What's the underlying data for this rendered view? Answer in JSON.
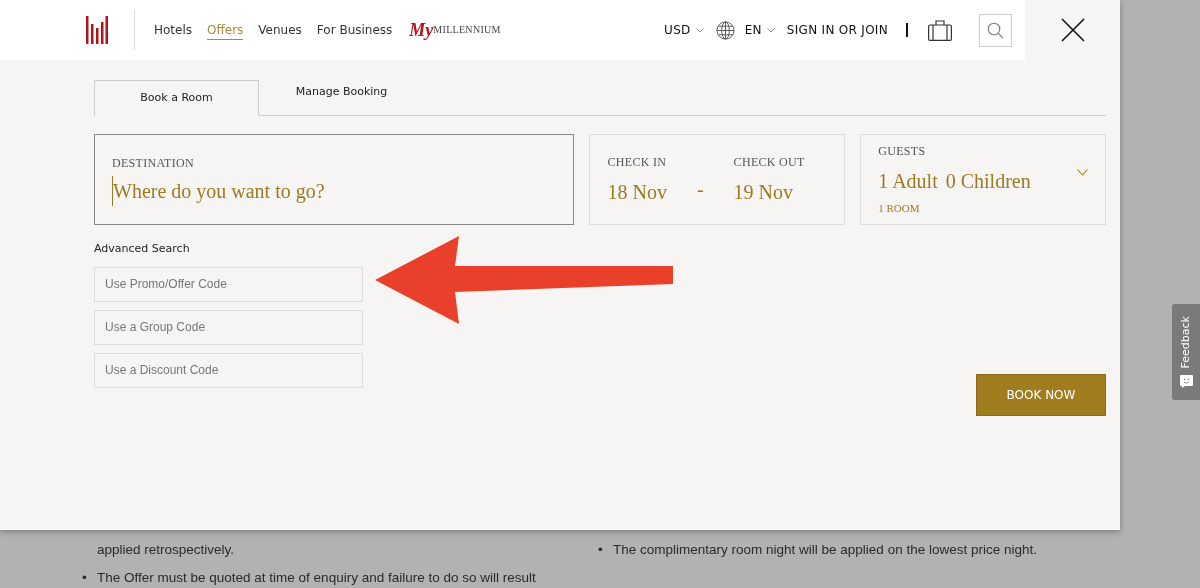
{
  "header": {
    "nav": [
      {
        "label": "Hotels",
        "selected": false
      },
      {
        "label": "Offers",
        "selected": true
      },
      {
        "label": "Venues",
        "selected": false
      },
      {
        "label": "For Business",
        "selected": false
      }
    ],
    "brand": {
      "script": "My",
      "name": "MILLENNIUM"
    },
    "currency": "USD",
    "language": "EN",
    "sign_in": "SIGN IN OR JOIN"
  },
  "tabs": [
    {
      "label": "Book a Room",
      "selected": true
    },
    {
      "label": "Manage Booking",
      "selected": false
    }
  ],
  "destination": {
    "label": "DESTINATION",
    "placeholder": "Where do you want to go?"
  },
  "dates": {
    "check_in": {
      "label": "CHECK IN",
      "value": "18 Nov"
    },
    "separator": "-",
    "check_out": {
      "label": "CHECK OUT",
      "value": "19 Nov"
    }
  },
  "guests": {
    "label": "GUESTS",
    "adults": "1 Adult",
    "children": "0 Children",
    "rooms": "1 ROOM"
  },
  "advanced_search": {
    "title": "Advanced Search",
    "fields": [
      {
        "placeholder": "Use Promo/Offer Code"
      },
      {
        "placeholder": "Use a Group Code"
      },
      {
        "placeholder": "Use a Discount Code"
      }
    ]
  },
  "book_button": "BOOK NOW",
  "feedback": "Feedback",
  "background_text": {
    "left": [
      {
        "text": "applied retrospectively."
      },
      {
        "bullet": "•",
        "text": "The Offer must be quoted at time of enquiry and failure to do so will result"
      }
    ],
    "right": [
      {
        "bullet": "•",
        "text": "The complimentary room night will be applied on the lowest price night."
      }
    ]
  }
}
